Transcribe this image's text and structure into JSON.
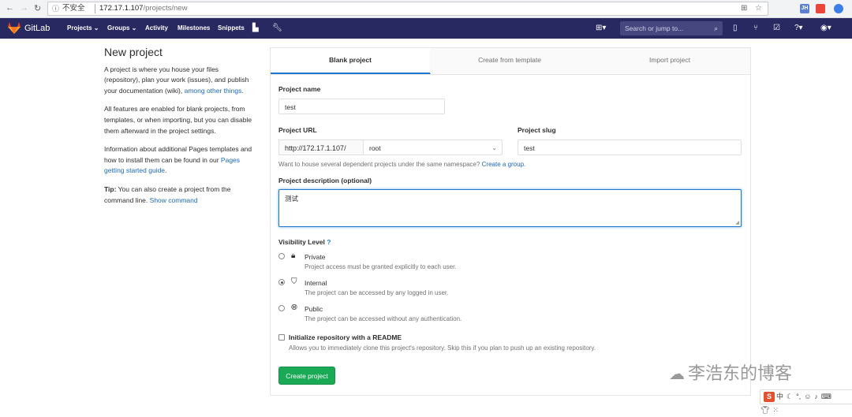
{
  "browser": {
    "insecure_label": "不安全",
    "host": "172.17.1.107",
    "path": "/projects/new",
    "ext_label": "JH"
  },
  "header": {
    "brand": "GitLab",
    "menu": [
      "Projects ⌄",
      "Groups ⌄",
      "Activity",
      "Milestones",
      "Snippets"
    ],
    "search_placeholder": "Search or jump to..."
  },
  "intro": {
    "title": "New project",
    "p1_text": "A project is where you house your files (repository), plan your work (issues), and publish your documentation (wiki),",
    "p1_link": "among other things",
    "p1_end": ".",
    "p2_text": "All features are enabled for blank projects, from templates, or when importing, but you can disable them afterward in the project settings.",
    "p3_text": "Information about additional Pages templates and how to install them can be found in our",
    "p3_link": "Pages getting started guide",
    "p3_end": ".",
    "tip_label": "Tip:",
    "tip_text": "You can also create a project from the command line.",
    "tip_link": "Show command"
  },
  "tabs": {
    "blank": "Blank project",
    "template": "Create from template",
    "import": "Import project"
  },
  "form": {
    "name_label": "Project name",
    "name_value": "test",
    "url_label": "Project URL",
    "url_prefix": "http://172.17.1.107/",
    "namespace_value": "root",
    "slug_label": "Project slug",
    "slug_value": "test",
    "group_help": "Want to house several dependent projects under the same namespace?",
    "group_link": "Create a group.",
    "desc_label": "Project description (optional)",
    "desc_value": "测试",
    "visibility_label": "Visibility Level",
    "visibility": [
      {
        "title": "Private",
        "desc": "Project access must be granted explicitly to each user.",
        "selected": false
      },
      {
        "title": "Internal",
        "desc": "The project can be accessed by any logged in user.",
        "selected": true
      },
      {
        "title": "Public",
        "desc": "The project can be accessed without any authentication.",
        "selected": false
      }
    ],
    "readme_label": "Initialize repository with a README",
    "readme_desc": "Allows you to immediately clone this project's repository. Skip this if you plan to push up an existing repository.",
    "readme_checked": false,
    "create_button": "Create project"
  },
  "watermark": {
    "text": "李浩东的博客",
    "ime_logo": "S",
    "ime_lang": "中"
  }
}
